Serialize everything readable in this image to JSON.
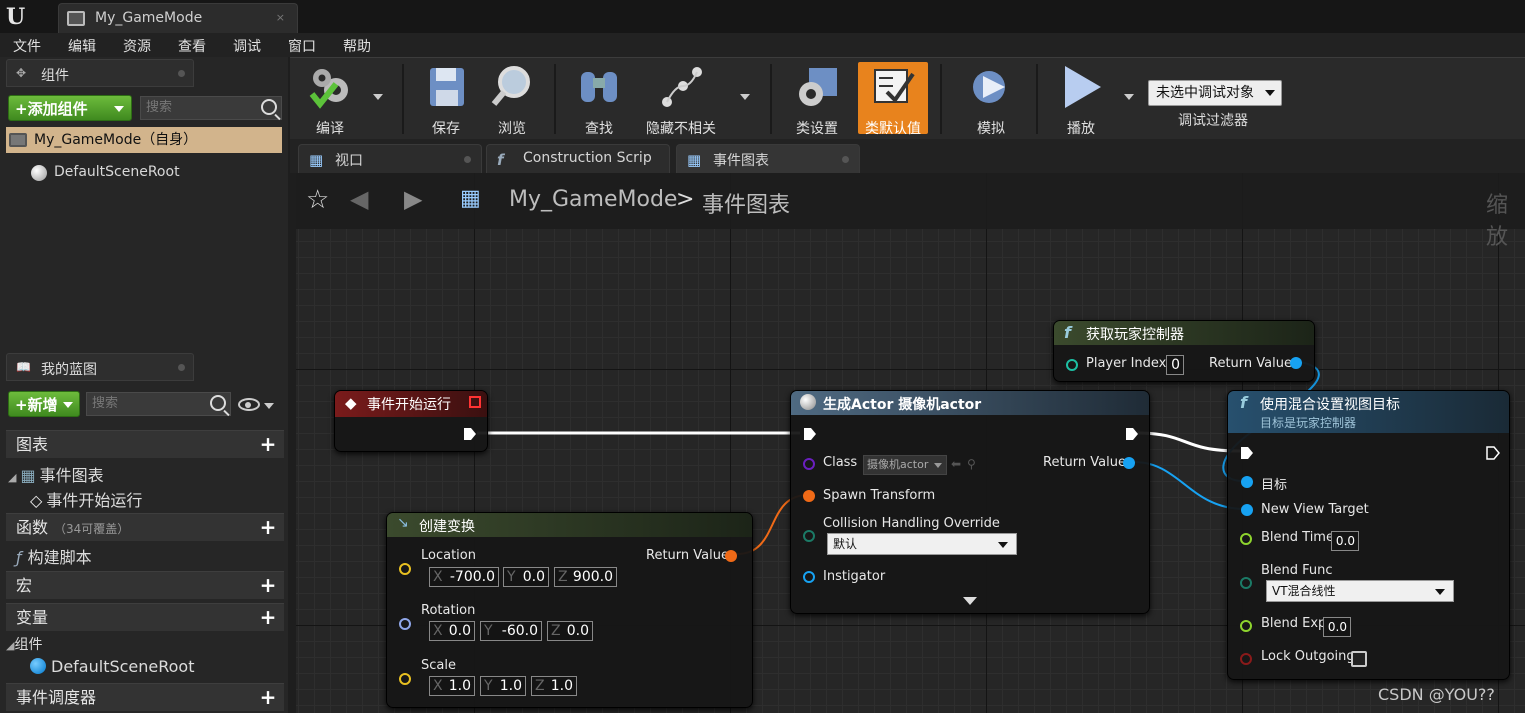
{
  "window": {
    "logo": "U",
    "doc_tab": "My_GameMode",
    "doc_tab_close": "×"
  },
  "menu": [
    "文件",
    "编辑",
    "资源",
    "查看",
    "调试",
    "窗口",
    "帮助"
  ],
  "components_panel": {
    "title": "组件",
    "add_button": "+添加组件",
    "search_placeholder": "搜索",
    "items": [
      "My_GameMode（自身）",
      "DefaultSceneRoot"
    ]
  },
  "blueprint_panel": {
    "title": "我的蓝图",
    "new_button": "+新增",
    "search_placeholder": "搜索",
    "sections": {
      "graphs": "图表",
      "event_graph": "事件图表",
      "begin_play": "事件开始运行",
      "functions": "函数",
      "functions_note": "（34可覆盖）",
      "construction": "构建脚本",
      "macros": "宏",
      "variables": "变量",
      "components": "组件",
      "default_root": "DefaultSceneRoot",
      "dispatchers": "事件调度器"
    }
  },
  "toolbar": {
    "compile": "编译",
    "save": "保存",
    "browse": "浏览",
    "find": "查找",
    "hide_unrelated": "隐藏不相关",
    "class_settings": "类设置",
    "class_defaults": "类默认值",
    "simulate": "模拟",
    "play": "播放",
    "debug_object": "未选中调试对象",
    "debug_filter": "调试过滤器"
  },
  "editor_tabs": [
    "视口",
    "Construction Scrip",
    "事件图表"
  ],
  "breadcrumb": {
    "root": "My_GameMode",
    "sep": ">",
    "current": "事件图表",
    "zoom": "缩放"
  },
  "nodes": {
    "begin_play": {
      "title": "事件开始运行"
    },
    "get_player_controller": {
      "title": "获取玩家控制器",
      "player_index_label": "Player Index",
      "player_index": "0",
      "return_label": "Return Value"
    },
    "spawn_actor": {
      "title": "生成Actor 摄像机actor",
      "class_label": "Class",
      "class_value": "摄像机actor",
      "return_label": "Return Value",
      "spawn_transform": "Spawn Transform",
      "collision_label": "Collision Handling Override",
      "collision_value": "默认",
      "instigator": "Instigator"
    },
    "make_transform": {
      "title": "创建变换",
      "return_label": "Return Value",
      "location_label": "Location",
      "location": [
        "-700.0",
        "0.0",
        "900.0"
      ],
      "rotation_label": "Rotation",
      "rotation": [
        "0.0",
        "-60.0",
        "0.0"
      ],
      "scale_label": "Scale",
      "scale": [
        "1.0",
        "1.0",
        "1.0"
      ],
      "axes": [
        "X",
        "Y",
        "Z"
      ]
    },
    "set_view_target": {
      "title": "使用混合设置视图目标",
      "subtitle": "目标是玩家控制器",
      "target": "目标",
      "new_view_target": "New View Target",
      "blend_time_label": "Blend Time",
      "blend_time": "0.0",
      "blend_func_label": "Blend Func",
      "blend_func": "VT混合线性",
      "blend_exp_label": "Blend Exp",
      "blend_exp": "0.0",
      "lock_outgoing": "Lock Outgoing"
    }
  },
  "watermark": "CSDN @YOU??",
  "colors": {
    "exec_wire": "#ffffff",
    "object_pin": "#17a2f2",
    "transform_pin": "#f06a17",
    "struct_pin": "#e8c021",
    "float_pin": "#8ed42e",
    "event_header": "#7a1b1b",
    "function_header": "#1f3a4e",
    "pure_header": "#3b4a2d",
    "selected_tool": "#e8831d"
  }
}
